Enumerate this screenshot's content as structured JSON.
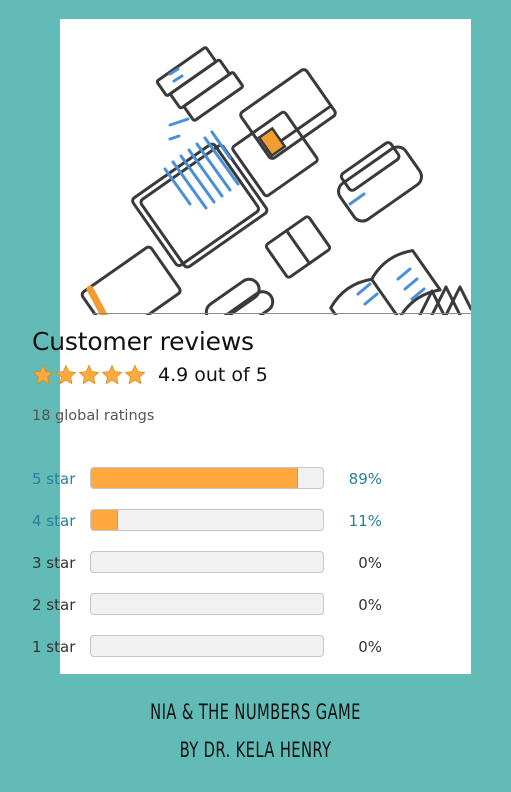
{
  "reviews": {
    "title": "Customer reviews",
    "average_text": "4.9 out of 5",
    "average_value": 4.9,
    "star_count": 5,
    "total_text": "18 global ratings",
    "rows": [
      {
        "label": "5 star",
        "percent_text": "89%",
        "percent": 89,
        "linked": true
      },
      {
        "label": "4 star",
        "percent_text": "11%",
        "percent": 11,
        "linked": true
      },
      {
        "label": "3 star",
        "percent_text": "0%",
        "percent": 0,
        "linked": false
      },
      {
        "label": "2 star",
        "percent_text": "0%",
        "percent": 0,
        "linked": false
      },
      {
        "label": "1 star",
        "percent_text": "0%",
        "percent": 0,
        "linked": false
      }
    ]
  },
  "caption": {
    "line1": "NIA & THE NUMBERS GAME",
    "line2": "BY DR. KELA HENRY"
  },
  "colors": {
    "background": "#62bbb6",
    "star": "#ffa940",
    "link": "#2a7e9a",
    "illustration_accent": "#f29c31",
    "illustration_blue": "#4a90d9"
  }
}
